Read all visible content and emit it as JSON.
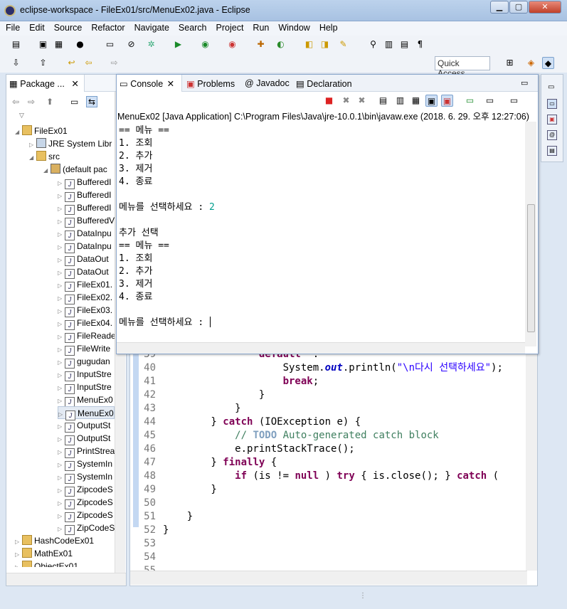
{
  "window": {
    "title": "eclipse-workspace - FileEx01/src/MenuEx02.java - Eclipse",
    "controls": [
      "▁",
      "▢",
      "✕"
    ]
  },
  "menu": [
    "File",
    "Edit",
    "Source",
    "Refactor",
    "Navigate",
    "Search",
    "Project",
    "Run",
    "Window",
    "Help"
  ],
  "toolbar": {
    "quick_access": "Quick Access"
  },
  "package_explorer": {
    "tab": "Package ...",
    "tree": [
      {
        "depth": 0,
        "tw": "◢",
        "icon": "folder",
        "label": "FileEx01"
      },
      {
        "depth": 1,
        "tw": "▷",
        "icon": "lib",
        "label": "JRE System Libr"
      },
      {
        "depth": 1,
        "tw": "◢",
        "icon": "folder",
        "label": "src"
      },
      {
        "depth": 2,
        "tw": "◢",
        "icon": "pkg",
        "label": "(default pac"
      },
      {
        "depth": 3,
        "tw": "▷",
        "icon": "J",
        "label": "BufferedI"
      },
      {
        "depth": 3,
        "tw": "▷",
        "icon": "J",
        "label": "BufferedI"
      },
      {
        "depth": 3,
        "tw": "▷",
        "icon": "J",
        "label": "BufferedI"
      },
      {
        "depth": 3,
        "tw": "▷",
        "icon": "J",
        "label": "BufferedV"
      },
      {
        "depth": 3,
        "tw": "▷",
        "icon": "J",
        "label": "DataInpu"
      },
      {
        "depth": 3,
        "tw": "▷",
        "icon": "J",
        "label": "DataInpu"
      },
      {
        "depth": 3,
        "tw": "▷",
        "icon": "J",
        "label": "DataOut"
      },
      {
        "depth": 3,
        "tw": "▷",
        "icon": "J",
        "label": "DataOut"
      },
      {
        "depth": 3,
        "tw": "▷",
        "icon": "J",
        "label": "FileEx01."
      },
      {
        "depth": 3,
        "tw": "▷",
        "icon": "J",
        "label": "FileEx02."
      },
      {
        "depth": 3,
        "tw": "▷",
        "icon": "J",
        "label": "FileEx03."
      },
      {
        "depth": 3,
        "tw": "▷",
        "icon": "J",
        "label": "FileEx04."
      },
      {
        "depth": 3,
        "tw": "▷",
        "icon": "J",
        "label": "FileReade"
      },
      {
        "depth": 3,
        "tw": "▷",
        "icon": "J",
        "label": "FileWrite"
      },
      {
        "depth": 3,
        "tw": "▷",
        "icon": "J",
        "label": "gugudan"
      },
      {
        "depth": 3,
        "tw": "▷",
        "icon": "J",
        "label": "InputStre"
      },
      {
        "depth": 3,
        "tw": "▷",
        "icon": "J",
        "label": "InputStre"
      },
      {
        "depth": 3,
        "tw": "▷",
        "icon": "J",
        "label": "MenuEx0"
      },
      {
        "depth": 3,
        "tw": "▷",
        "icon": "J",
        "label": "MenuEx0",
        "selected": true
      },
      {
        "depth": 3,
        "tw": "▷",
        "icon": "J",
        "label": "OutputSt"
      },
      {
        "depth": 3,
        "tw": "▷",
        "icon": "J",
        "label": "OutputSt"
      },
      {
        "depth": 3,
        "tw": "▷",
        "icon": "J",
        "label": "PrintStrea"
      },
      {
        "depth": 3,
        "tw": "▷",
        "icon": "J",
        "label": "SystemIn"
      },
      {
        "depth": 3,
        "tw": "▷",
        "icon": "J",
        "label": "SystemIn"
      },
      {
        "depth": 3,
        "tw": "▷",
        "icon": "J",
        "label": "ZipcodeS"
      },
      {
        "depth": 3,
        "tw": "▷",
        "icon": "J",
        "label": "ZipcodeS"
      },
      {
        "depth": 3,
        "tw": "▷",
        "icon": "J",
        "label": "ZipcodeS"
      },
      {
        "depth": 3,
        "tw": "▷",
        "icon": "J",
        "label": "ZipCodeS"
      },
      {
        "depth": 0,
        "tw": "▷",
        "icon": "folder",
        "label": "HashCodeEx01"
      },
      {
        "depth": 0,
        "tw": "▷",
        "icon": "folder",
        "label": "MathEx01"
      },
      {
        "depth": 0,
        "tw": "▷",
        "icon": "folder",
        "label": "ObjectEx01"
      }
    ]
  },
  "console": {
    "tabs": [
      "Console",
      "Problems",
      "Javadoc",
      "Declaration"
    ],
    "launch": "MenuEx02 [Java Application] C:\\Program Files\\Java\\jre-10.0.1\\bin\\javaw.exe (2018. 6. 29. 오후 12:27:06)",
    "lines": [
      {
        "text": "== 메뉴 =="
      },
      {
        "text": "1. 조회"
      },
      {
        "text": "2. 추가"
      },
      {
        "text": "3. 제거"
      },
      {
        "text": "4. 종료"
      },
      {
        "text": ""
      },
      {
        "text": "메뉴를 선택하세요 : ",
        "input": "2"
      },
      {
        "text": ""
      },
      {
        "text": "추가 선택"
      },
      {
        "text": "== 메뉴 =="
      },
      {
        "text": "1. 조회"
      },
      {
        "text": "2. 추가"
      },
      {
        "text": "3. 제거"
      },
      {
        "text": "4. 종료"
      },
      {
        "text": ""
      },
      {
        "text": "메뉴를 선택하세요 : ",
        "caret": true
      }
    ]
  },
  "editor": {
    "lines": [
      {
        "n": "39",
        "code": [
          [
            "kw",
            "                default"
          ],
          [
            "",
            "  :"
          ]
        ]
      },
      {
        "n": "40",
        "code": [
          [
            "",
            "                    System."
          ],
          [
            "fld",
            "out"
          ],
          [
            "",
            ".println("
          ],
          [
            "str",
            "\"\\n다시 선택하세요\""
          ],
          [
            "",
            ");"
          ]
        ]
      },
      {
        "n": "41",
        "code": [
          [
            "kw",
            "                    break"
          ],
          [
            "",
            ";"
          ]
        ]
      },
      {
        "n": "42",
        "code": [
          [
            "",
            "                }"
          ]
        ]
      },
      {
        "n": "43",
        "code": [
          [
            "",
            "            }"
          ]
        ]
      },
      {
        "n": "44",
        "code": [
          [
            "",
            "        } "
          ],
          [
            "kw",
            "catch"
          ],
          [
            "",
            " (IOException e) {"
          ]
        ]
      },
      {
        "n": "45",
        "code": [
          [
            "cm",
            "            // "
          ],
          [
            "todo",
            "TODO"
          ],
          [
            "cm",
            " Auto-generated catch block"
          ]
        ]
      },
      {
        "n": "46",
        "code": [
          [
            "",
            "            e.printStackTrace();"
          ]
        ]
      },
      {
        "n": "47",
        "code": [
          [
            "",
            "        } "
          ],
          [
            "kw",
            "finally"
          ],
          [
            "",
            " {"
          ]
        ]
      },
      {
        "n": "48",
        "code": [
          [
            "kw",
            "            if"
          ],
          [
            "",
            " (is != "
          ],
          [
            "kw",
            "null"
          ],
          [
            "",
            " ) "
          ],
          [
            "kw",
            "try"
          ],
          [
            "",
            " { is.close(); } "
          ],
          [
            "kw",
            "catch"
          ],
          [
            "",
            " ("
          ]
        ]
      },
      {
        "n": "49",
        "code": [
          [
            "",
            "        }"
          ]
        ]
      },
      {
        "n": "50",
        "code": [
          [
            "",
            ""
          ]
        ]
      },
      {
        "n": "51",
        "code": [
          [
            "",
            "    }"
          ]
        ]
      },
      {
        "n": "52",
        "code": [
          [
            "",
            "}"
          ]
        ]
      },
      {
        "n": "53",
        "code": [
          [
            "",
            ""
          ]
        ]
      },
      {
        "n": "54",
        "code": [
          [
            "",
            ""
          ]
        ]
      },
      {
        "n": "55",
        "code": [
          [
            "",
            ""
          ]
        ]
      }
    ]
  }
}
